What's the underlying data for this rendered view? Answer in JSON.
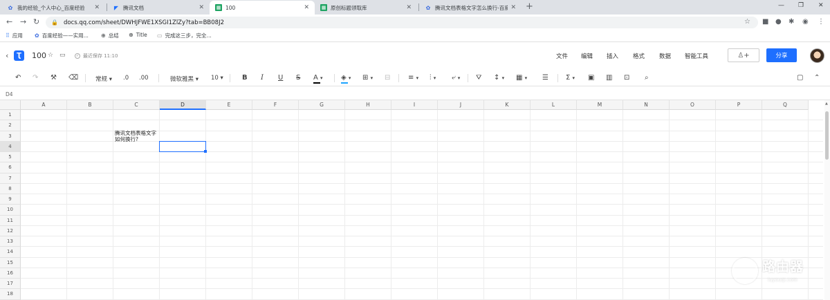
{
  "browser": {
    "tabs": [
      {
        "title": "我的经验_个人中心_百度经验",
        "icon": "baidu-paw-icon"
      },
      {
        "title": "腾讯文档",
        "icon": "tencent-docs-icon"
      },
      {
        "title": "100",
        "icon": "sheet-icon",
        "active": true
      },
      {
        "title": "原创标题领取库",
        "icon": "sheet-icon"
      },
      {
        "title": "腾讯文档表格文字怎么换行-百度…",
        "icon": "baidu-paw-icon"
      }
    ],
    "url": "docs.qq.com/sheet/DWHJFWE1XSGI1ZlZy?tab=BB08J2",
    "bookmarks": [
      {
        "label": "应用",
        "icon": "apps-grid-icon"
      },
      {
        "label": "百度经验——实用...",
        "icon": "baidu-paw-icon"
      },
      {
        "label": "总结",
        "icon": "globe-icon"
      },
      {
        "label": "Title",
        "icon": "globe-icon"
      },
      {
        "label": "完成这三步，完全...",
        "icon": "page-icon"
      }
    ]
  },
  "app": {
    "doc_name": "100",
    "save_status": "最近保存 11:10",
    "menu": [
      "文件",
      "编辑",
      "插入",
      "格式",
      "数据",
      "智能工具"
    ],
    "share_label": "分享",
    "add_collab_icon": "person-plus-icon"
  },
  "toolbar": {
    "format_dropdown": "常规",
    "decimal_decrease": ".0",
    "decimal_increase": ".00",
    "font_family": "微软雅黑",
    "font_size": "10",
    "text_color": "#000000",
    "fill_color": "#1aa3ff"
  },
  "formula_bar": {
    "cell_ref": "D4"
  },
  "sheet": {
    "columns": [
      "A",
      "B",
      "C",
      "D",
      "E",
      "F",
      "G",
      "H",
      "I",
      "J",
      "K",
      "L",
      "M",
      "N",
      "O",
      "P",
      "Q"
    ],
    "rows": [
      "1",
      "2",
      "3",
      "4",
      "5",
      "6",
      "7",
      "8",
      "9",
      "10",
      "11",
      "12",
      "13",
      "14",
      "15",
      "16",
      "17",
      "18"
    ],
    "selected_col": "D",
    "selected_row": "4",
    "c3_line1": "腾讯文档表格文字",
    "c3_line2": "如何换行?"
  },
  "watermark": {
    "title": "路由器",
    "subtitle": "luyouqi.com"
  }
}
